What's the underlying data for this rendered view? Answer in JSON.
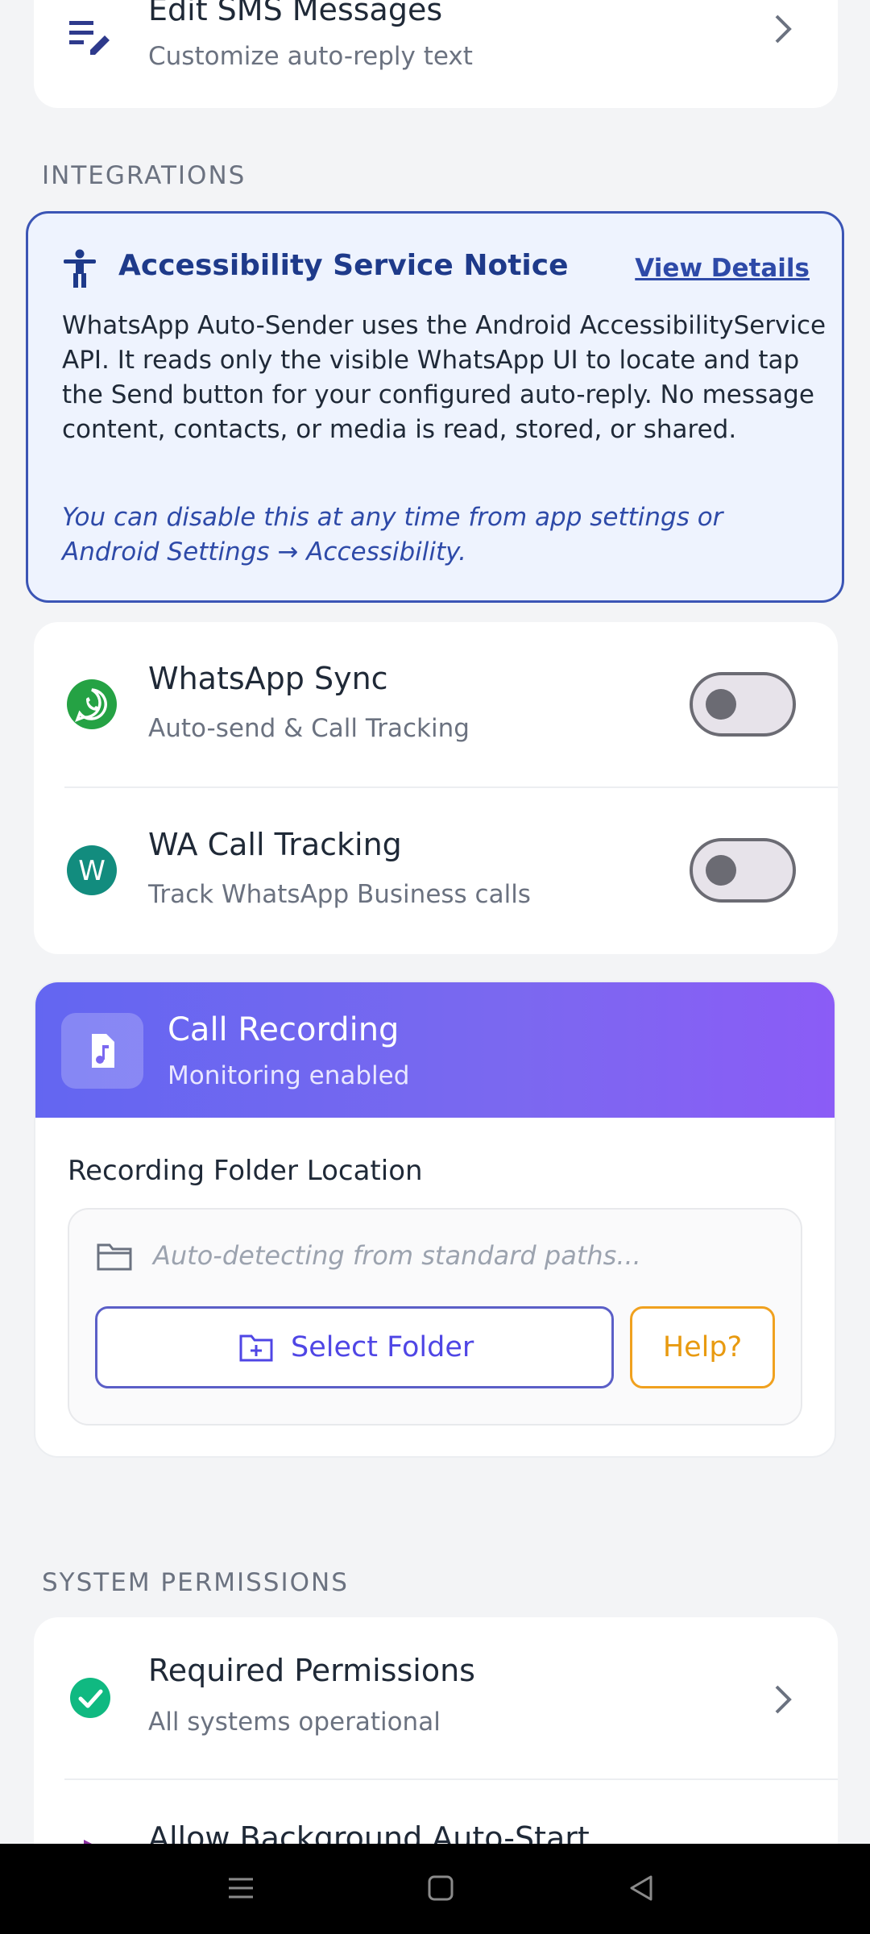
{
  "sms_card": {
    "title": "Edit SMS Messages",
    "subtitle": "Customize auto-reply text",
    "icon": "edit-list-icon"
  },
  "sections": {
    "integrations": "INTEGRATIONS",
    "system_permissions": "SYSTEM PERMISSIONS"
  },
  "notice": {
    "title": "Accessibility Service Notice",
    "link": "View Details",
    "body": "WhatsApp Auto-Sender uses the Android AccessibilityService API. It reads only the visible WhatsApp UI to locate and tap the Send button for your configured auto-reply. No message content, contacts, or media is read, stored, or shared.",
    "note": "You can disable this at any time from app settings or Android Settings → Accessibility.",
    "icon": "accessibility-icon"
  },
  "whatsapp": {
    "sync_title": "WhatsApp Sync",
    "sync_sub": "Auto-send & Call Tracking",
    "sync_on": false,
    "call_title": "WA Call Tracking",
    "call_sub": "Track WhatsApp Business calls",
    "call_icon_letter": "W",
    "call_on": false
  },
  "recording": {
    "title": "Call Recording",
    "subtitle": "Monitoring enabled",
    "folder_label": "Recording Folder Location",
    "path_placeholder": "Auto-detecting from standard paths...",
    "select_button": "Select Folder",
    "help_button": "Help?"
  },
  "permissions": {
    "required_title": "Required Permissions",
    "required_sub": "All systems operational",
    "autostart_title": "Allow Background Auto-Start"
  },
  "colors": {
    "accent": "#4f46e5",
    "whatsapp_green": "#25d366",
    "success_green": "#10b981",
    "help_orange": "#f0a11f",
    "notice_blue": "#3b55b5"
  }
}
